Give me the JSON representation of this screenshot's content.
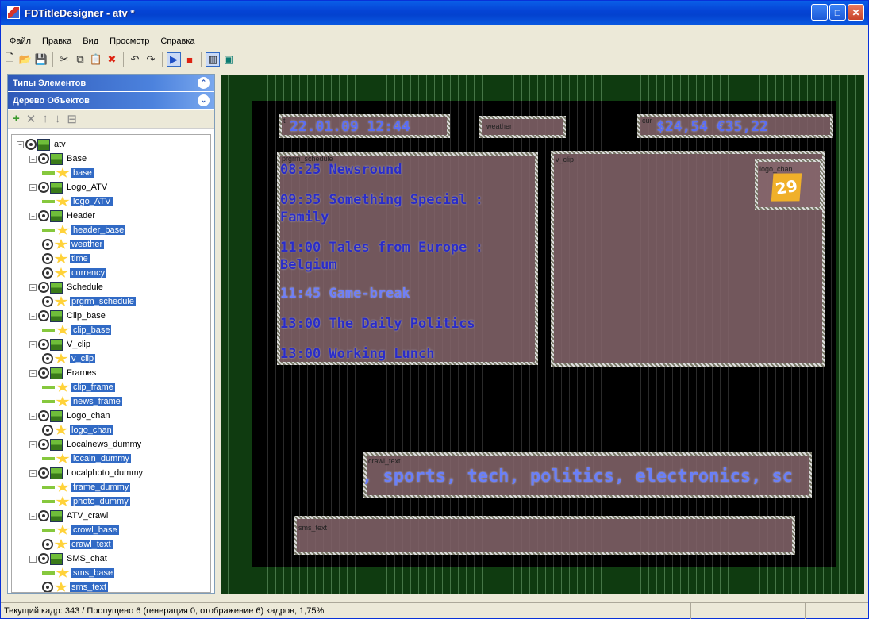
{
  "window": {
    "title": "FDTitleDesigner - atv *"
  },
  "menu": [
    "Файл",
    "Правка",
    "Вид",
    "Просмотр",
    "Справка"
  ],
  "panels": {
    "element_types": "Типы Элементов",
    "object_tree": "Дерево Объектов"
  },
  "tree": [
    {
      "label": "atv",
      "kind": "root",
      "level": 0
    },
    {
      "label": "Base",
      "kind": "group",
      "level": 1
    },
    {
      "label": "base",
      "kind": "leaf",
      "level": 2
    },
    {
      "label": "Logo_ATV",
      "kind": "group",
      "level": 1
    },
    {
      "label": "logo_ATV",
      "kind": "leaf",
      "level": 2
    },
    {
      "label": "Header",
      "kind": "group",
      "level": 1
    },
    {
      "label": "header_base",
      "kind": "leaf",
      "level": 2
    },
    {
      "label": "weather",
      "kind": "leaf-eye",
      "level": 2
    },
    {
      "label": "time",
      "kind": "leaf-eye",
      "level": 2
    },
    {
      "label": "currency",
      "kind": "leaf-eye",
      "level": 2
    },
    {
      "label": "Schedule",
      "kind": "group",
      "level": 1
    },
    {
      "label": "prgrm_schedule",
      "kind": "leaf-eye",
      "level": 2
    },
    {
      "label": "Clip_base",
      "kind": "group",
      "level": 1
    },
    {
      "label": "clip_base",
      "kind": "leaf",
      "level": 2
    },
    {
      "label": "V_clip",
      "kind": "group",
      "level": 1
    },
    {
      "label": "v_clip",
      "kind": "leaf-eye",
      "level": 2
    },
    {
      "label": "Frames",
      "kind": "group",
      "level": 1
    },
    {
      "label": "clip_frame",
      "kind": "leaf",
      "level": 2
    },
    {
      "label": "news_frame",
      "kind": "leaf",
      "level": 2
    },
    {
      "label": "Logo_chan",
      "kind": "group",
      "level": 1
    },
    {
      "label": "logo_chan",
      "kind": "leaf-eye",
      "level": 2
    },
    {
      "label": "Localnews_dummy",
      "kind": "group",
      "level": 1
    },
    {
      "label": "localn_dummy",
      "kind": "leaf",
      "level": 2
    },
    {
      "label": "Localphoto_dummy",
      "kind": "group",
      "level": 1
    },
    {
      "label": "frame_dummy",
      "kind": "leaf",
      "level": 2
    },
    {
      "label": "photo_dummy",
      "kind": "leaf",
      "level": 2
    },
    {
      "label": "ATV_crawl",
      "kind": "group",
      "level": 1
    },
    {
      "label": "crowl_base",
      "kind": "leaf",
      "level": 2
    },
    {
      "label": "crawl_text",
      "kind": "leaf-eye",
      "level": 2
    },
    {
      "label": "SMS_chat",
      "kind": "group",
      "level": 1
    },
    {
      "label": "sms_base",
      "kind": "leaf",
      "level": 2
    },
    {
      "label": "sms_text",
      "kind": "leaf-eye",
      "level": 2
    }
  ],
  "canvas": {
    "datetime": "22.01.09  12:44",
    "weather_tag": "weather",
    "currency": "$24,54  €35,22",
    "schedule_tag": "prgrm_schedule",
    "schedule": [
      "08:25 Newsround",
      "09:35 Something Special :",
      "Family",
      "11:00 Tales from Europe :",
      "Belgium",
      "11:45 Game-break",
      "13:00 The Daily Politics",
      "13:00 Working Lunch"
    ],
    "vclip_tag": "v_clip",
    "logo_tag": "logo_chan",
    "crawl_tag": "crawl_text",
    "crawl_text": ", sports, tech, politics, electronics, sc",
    "sms_tag": "sms_text",
    "dt_tag": "ti",
    "cur_tag": "cur"
  },
  "status": {
    "text": "Текущий кадр: 343 / Пропущено 6 (генерация 0, отображение 6) кадров,  1,75%"
  }
}
